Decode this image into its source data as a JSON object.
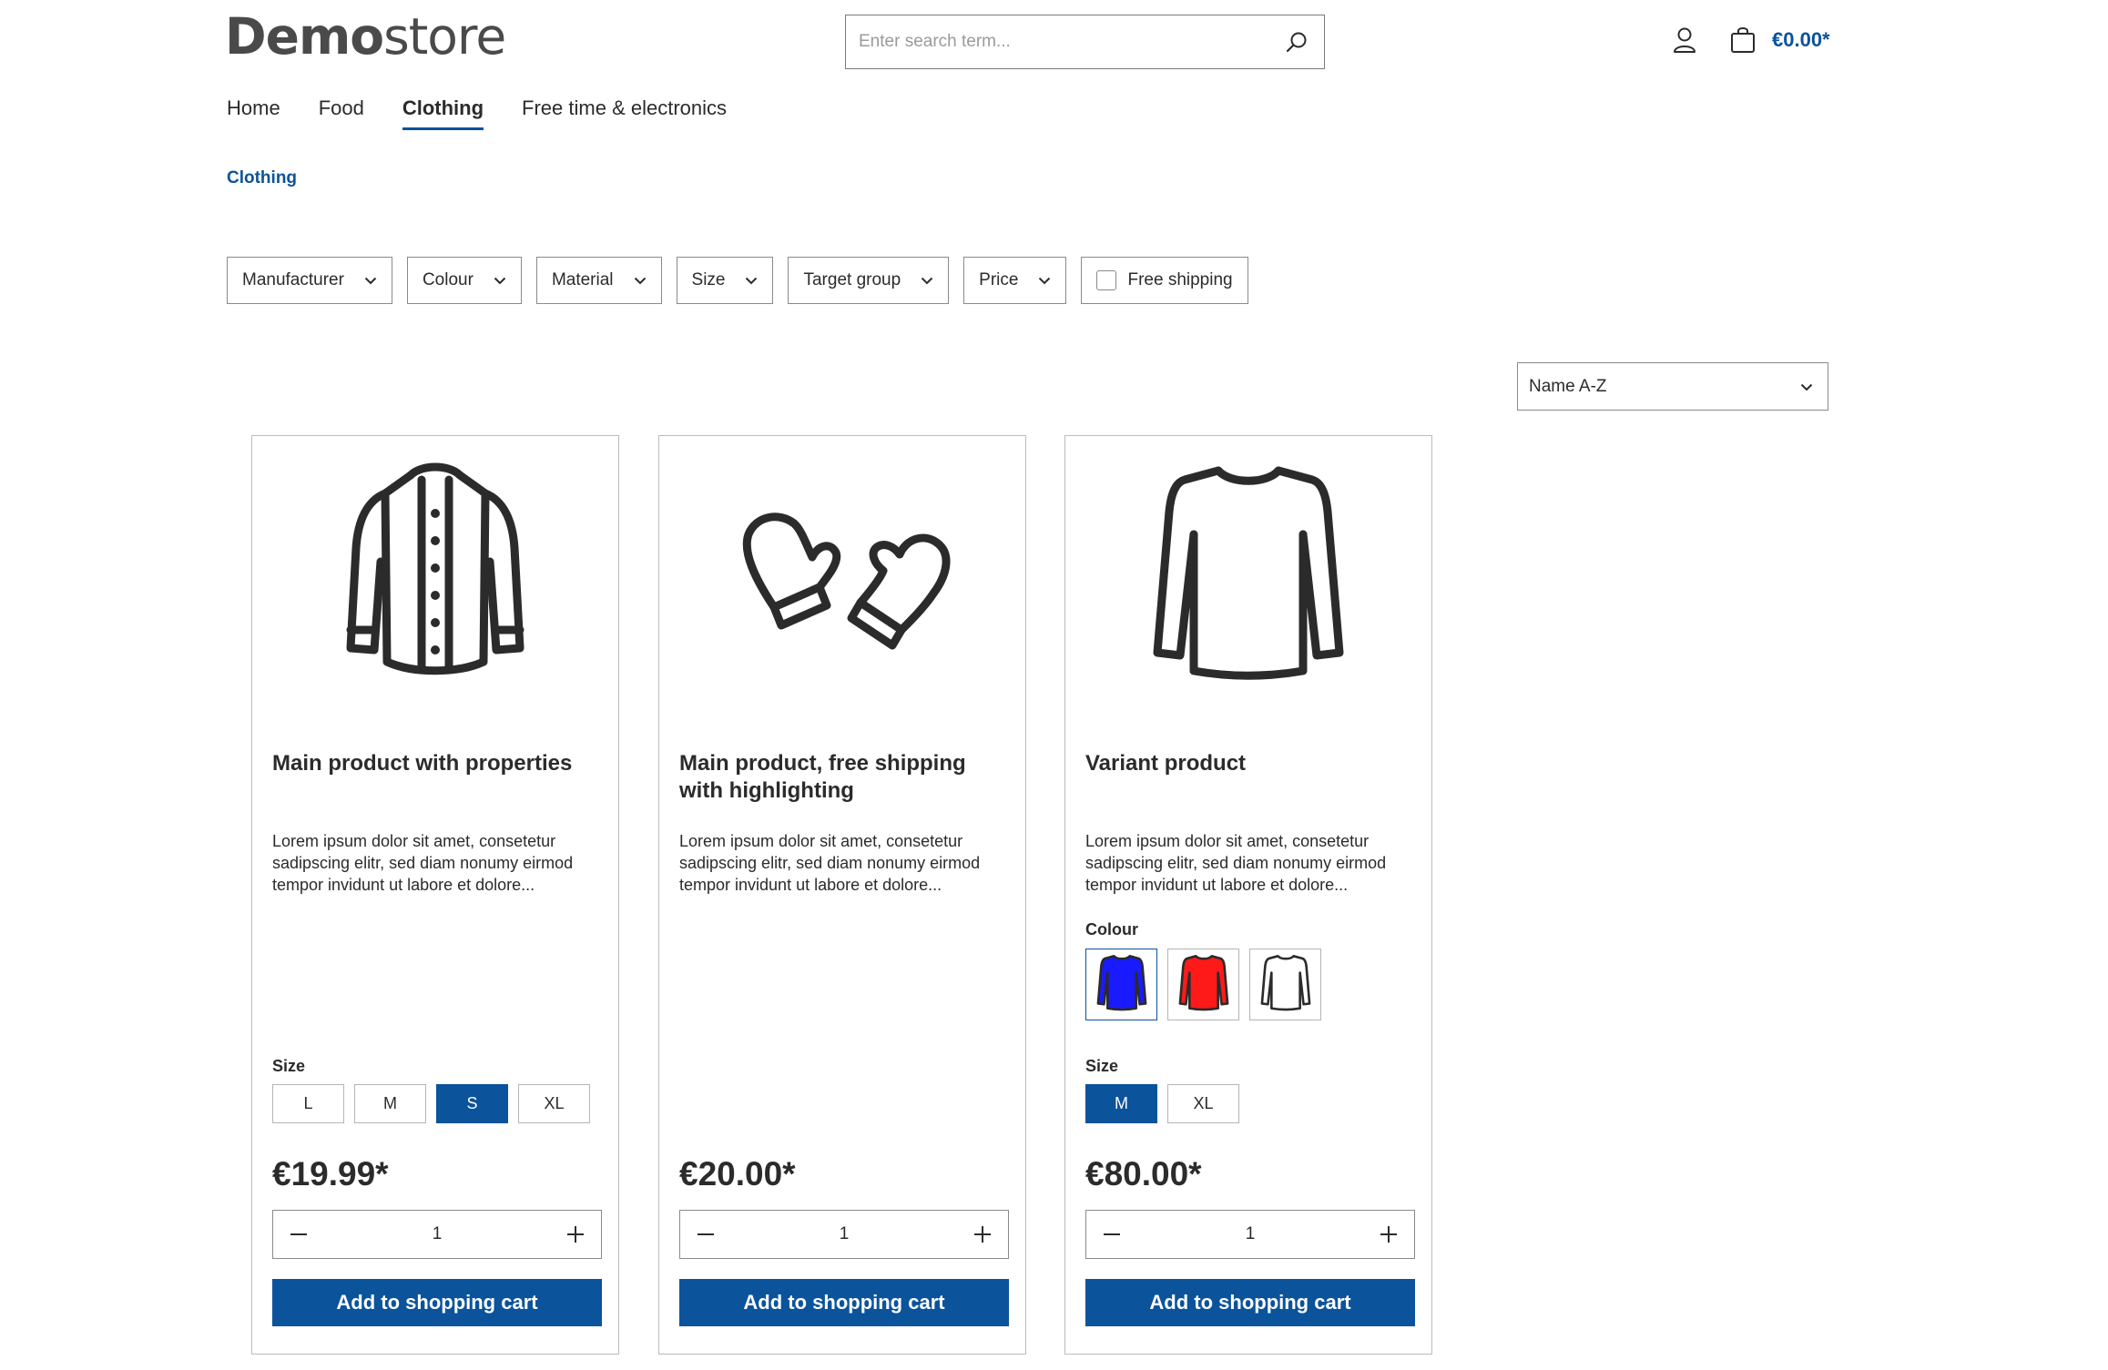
{
  "brand": {
    "logo_bold": "Demo",
    "logo_light": "store"
  },
  "search": {
    "placeholder": "Enter search term...",
    "value": ""
  },
  "header": {
    "cart_total": "€0.00*"
  },
  "nav": {
    "items": [
      "Home",
      "Food",
      "Clothing",
      "Free time & electronics"
    ],
    "active": "Clothing"
  },
  "breadcrumb": {
    "current": "Clothing"
  },
  "filters": {
    "manufacturer": "Manufacturer",
    "colour": "Colour",
    "material": "Material",
    "size": "Size",
    "target_group": "Target group",
    "price": "Price",
    "free_shipping": "Free shipping"
  },
  "sorting": {
    "selected": "Name A-Z"
  },
  "products": [
    {
      "name": "Main product with properties",
      "description": "Lorem ipsum dolor sit amet, consetetur sadipscing elitr, sed diam nonumy eirmod tempor invidunt ut labore et dolore...",
      "image_icon": "jacket-icon",
      "size_label": "Size",
      "sizes": [
        "L",
        "M",
        "S",
        "XL"
      ],
      "selected_size": "S",
      "price": "€19.99*",
      "quantity": "1",
      "cta": "Add to shopping cart"
    },
    {
      "name": "Main product, free shipping with highlighting",
      "description": "Lorem ipsum dolor sit amet, consetetur sadipscing elitr, sed diam nonumy eirmod tempor invidunt ut labore et dolore...",
      "image_icon": "mittens-icon",
      "price": "€20.00*",
      "quantity": "1",
      "cta": "Add to shopping cart"
    },
    {
      "name": "Variant product",
      "description": "Lorem ipsum dolor sit amet, consetetur sadipscing elitr, sed diam nonumy eirmod tempor invidunt ut labore et dolore...",
      "image_icon": "sweater-icon",
      "colour_label": "Colour",
      "colours": [
        "#1a1aff",
        "#ff1a1a",
        "#ffffff"
      ],
      "size_label": "Size",
      "sizes": [
        "M",
        "XL"
      ],
      "selected_size": "M",
      "price": "€80.00*",
      "quantity": "1",
      "cta": "Add to shopping cart"
    }
  ],
  "colors": {
    "accent": "#0b539b",
    "text": "#2b2b2b",
    "border": "#bcbcbc"
  }
}
